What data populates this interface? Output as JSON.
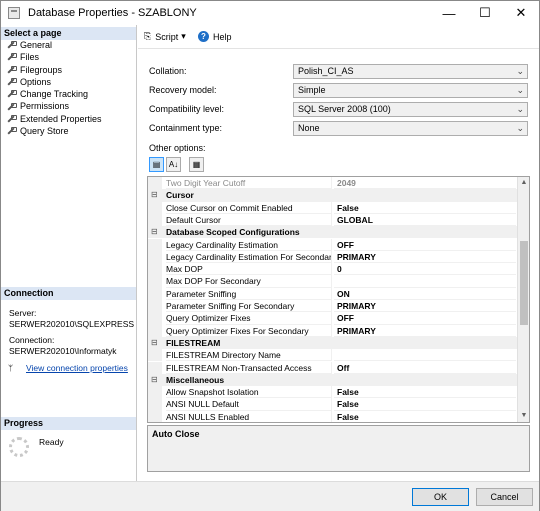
{
  "window": {
    "title": "Database Properties - SZABLONY",
    "minimize_glyph": "—",
    "maximize_glyph": "☐",
    "close_glyph": "✕"
  },
  "select_page": {
    "header": "Select a page",
    "items": [
      {
        "label": "General"
      },
      {
        "label": "Files"
      },
      {
        "label": "Filegroups"
      },
      {
        "label": "Options"
      },
      {
        "label": "Change Tracking"
      },
      {
        "label": "Permissions"
      },
      {
        "label": "Extended Properties"
      },
      {
        "label": "Query Store"
      }
    ]
  },
  "connection": {
    "header": "Connection",
    "server_label": "Server:",
    "server_value": "SERWER202010\\SQLEXPRESS",
    "connection_label": "Connection:",
    "connection_value": "SERWER202010\\Informatyk",
    "view_link": "View connection properties"
  },
  "progress": {
    "header": "Progress",
    "status": "Ready"
  },
  "toolbar": {
    "script_label": "Script",
    "script_arrow": "▾",
    "help_label": "Help",
    "help_glyph": "?"
  },
  "fields": [
    {
      "label": "Collation:",
      "value": "Polish_CI_AS"
    },
    {
      "label": "Recovery model:",
      "value": "Simple"
    },
    {
      "label": "Compatibility level:",
      "value": "SQL Server 2008 (100)"
    },
    {
      "label": "Containment type:",
      "value": "None"
    }
  ],
  "combo_arrow": "⌄",
  "other_options_label": "Other options:",
  "grid_buttons": {
    "categorized": "▤",
    "alphabetical": "A↓",
    "pages": "▦"
  },
  "property_grid": {
    "collapse_glyph": "⊟",
    "scroll_up": "▲",
    "scroll_down": "▼",
    "rows": [
      {
        "kind": "prop",
        "name": "Two Digit Year Cutoff",
        "value": "2049",
        "disabled": true
      },
      {
        "kind": "cat",
        "name": "Cursor"
      },
      {
        "kind": "prop",
        "name": "Close Cursor on Commit Enabled",
        "value": "False"
      },
      {
        "kind": "prop",
        "name": "Default Cursor",
        "value": "GLOBAL"
      },
      {
        "kind": "cat",
        "name": "Database Scoped Configurations"
      },
      {
        "kind": "prop",
        "name": "Legacy Cardinality Estimation",
        "value": "OFF"
      },
      {
        "kind": "prop",
        "name": "Legacy Cardinality Estimation For Secondary",
        "value": "PRIMARY"
      },
      {
        "kind": "prop",
        "name": "Max DOP",
        "value": "0"
      },
      {
        "kind": "prop",
        "name": "Max DOP For Secondary",
        "value": ""
      },
      {
        "kind": "prop",
        "name": "Parameter Sniffing",
        "value": "ON"
      },
      {
        "kind": "prop",
        "name": "Parameter Sniffing For Secondary",
        "value": "PRIMARY"
      },
      {
        "kind": "prop",
        "name": "Query Optimizer Fixes",
        "value": "OFF"
      },
      {
        "kind": "prop",
        "name": "Query Optimizer Fixes For Secondary",
        "value": "PRIMARY"
      },
      {
        "kind": "cat",
        "name": "FILESTREAM"
      },
      {
        "kind": "prop",
        "name": "FILESTREAM Directory Name",
        "value": ""
      },
      {
        "kind": "prop",
        "name": "FILESTREAM Non-Transacted Access",
        "value": "Off"
      },
      {
        "kind": "cat",
        "name": "Miscellaneous"
      },
      {
        "kind": "prop",
        "name": "Allow Snapshot Isolation",
        "value": "False"
      },
      {
        "kind": "prop",
        "name": "ANSI NULL Default",
        "value": "False"
      },
      {
        "kind": "prop",
        "name": "ANSI NULLS Enabled",
        "value": "False"
      }
    ]
  },
  "description": {
    "title": "Auto Close"
  },
  "footer": {
    "ok_label": "OK",
    "cancel_label": "Cancel"
  },
  "colors": {
    "section_header_bg": "#dce6f4",
    "link": "#0645ad",
    "help_icon": "#1e6fc7",
    "default_button_border": "#0078d7"
  }
}
